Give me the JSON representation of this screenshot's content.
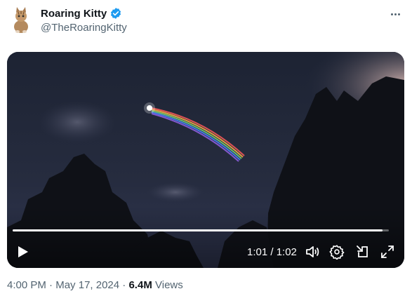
{
  "author": {
    "display_name": "Roaring Kitty",
    "handle": "@TheRoaringKitty",
    "verified": true,
    "avatar_icon": "cat-avatar-icon"
  },
  "video": {
    "current_time": "1:01",
    "duration": "1:02",
    "time_display": "1:01 / 1:02",
    "progress_fraction": 0.984,
    "controls": [
      "play-icon",
      "volume-icon",
      "settings-gear-icon",
      "picture-in-picture-icon",
      "fullscreen-expand-icon"
    ]
  },
  "meta": {
    "time": "4:00 PM",
    "separator": "·",
    "date": "May 17, 2024",
    "views_count": "6.4M",
    "views_label": "Views"
  },
  "colors": {
    "text": "#0f1419",
    "secondary": "#536471",
    "verified": "#1d9bf0"
  }
}
